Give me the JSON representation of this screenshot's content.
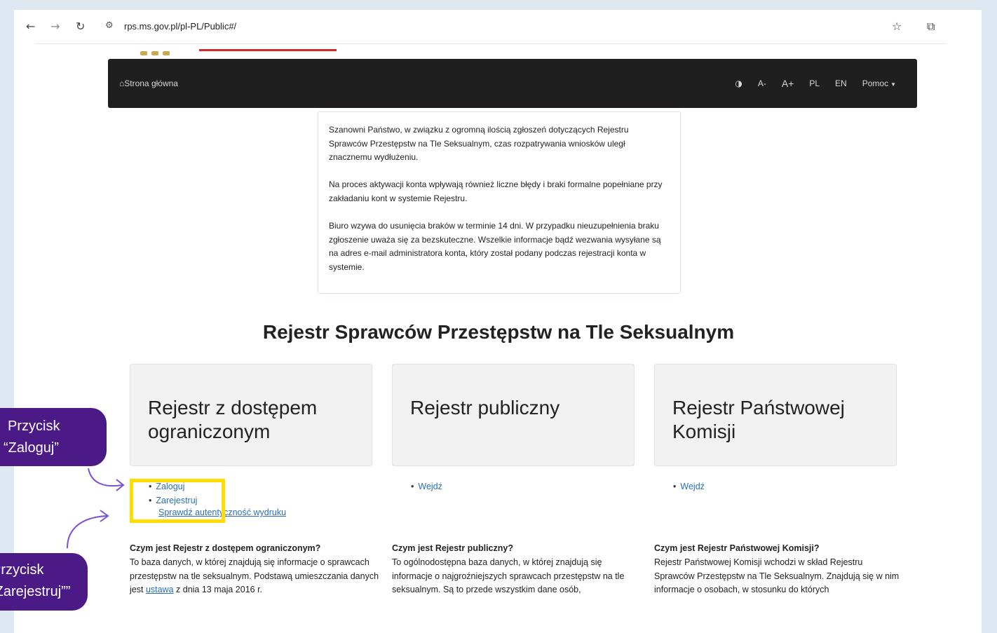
{
  "browser": {
    "url": "rps.ms.gov.pl/pl-PL/Public#/",
    "icons": [
      "back-arrow-icon",
      "forward-arrow-icon",
      "reload-icon",
      "site-settings-icon",
      "star-icon",
      "extensions-icon"
    ]
  },
  "nav": {
    "home_label": "Strona główna",
    "contrast_icon": "contrast-icon",
    "font_smaller": "A-",
    "font_larger": "A+",
    "lang_pl": "PL",
    "lang_en": "EN",
    "help": "Pomoc"
  },
  "notice": {
    "p1": "Szanowni Państwo, w związku z ogromną ilością zgłoszeń dotyczących Rejestru Sprawców Przestępstw na Tle Seksualnym, czas rozpatrywania wniosków uległ znacznemu wydłużeniu.",
    "p2": "Na proces aktywacji konta wpływają również liczne błędy i braki formalne popełniane przy zakładaniu kont w systemie Rejestru.",
    "p3": "Biuro wzywa do usunięcia braków w terminie 14 dni. W przypadku nieuzupełnienia braku zgłoszenie uważa się za bezskuteczne. Wszelkie informacje bądź wezwania wysyłane są na adres e-mail administratora konta, który został podany podczas rejestracji konta w systemie."
  },
  "page_title": "Rejestr Sprawców Przestępstw na Tle Seksualnym",
  "cards": [
    {
      "title": "Rejestr z dostępem ograniczonym",
      "links": [
        "Zaloguj",
        "Zarejestruj"
      ],
      "extra_link": "Sprawdź autentyczność wydruku",
      "desc_title": "Czym jest Rejestr z dostępem ograniczonym?",
      "desc_before_link": "To baza danych, w której znajdują się informacje o sprawcach przestępstw na tle seksualnym. Podstawą umieszczania danych jest ",
      "desc_link": "ustawa",
      "desc_after_link": " z dnia 13 maja 2016 r."
    },
    {
      "title": "Rejestr publiczny",
      "links": [
        "Wejdź"
      ],
      "desc_title": "Czym jest Rejestr publiczny?",
      "desc_text": "To ogólnodostępna baza danych, w której znajdują się informacje o najgroźniejszych sprawcach przestępstw na tle seksualnym. Są to przede wszystkim dane osób,"
    },
    {
      "title": "Rejestr Państwowej Komisji",
      "links": [
        "Wejdź"
      ],
      "desc_title": "Czym jest Rejestr Państwowej Komisji?",
      "desc_text": "Rejestr Państwowej Komisji wchodzi w skład Rejestru Sprawców Przestępstw na Tle Seksualnym. Znajdują się w nim informacje o osobach, w stosunku do których"
    }
  ],
  "annotations": {
    "bubble1": [
      "Przycisk",
      "“Zaloguj”"
    ],
    "bubble2": [
      "Przycisk",
      "“Zarejestruj””"
    ],
    "highlight_color": "#ffdd00",
    "bubble_color": "#4b1a86"
  }
}
